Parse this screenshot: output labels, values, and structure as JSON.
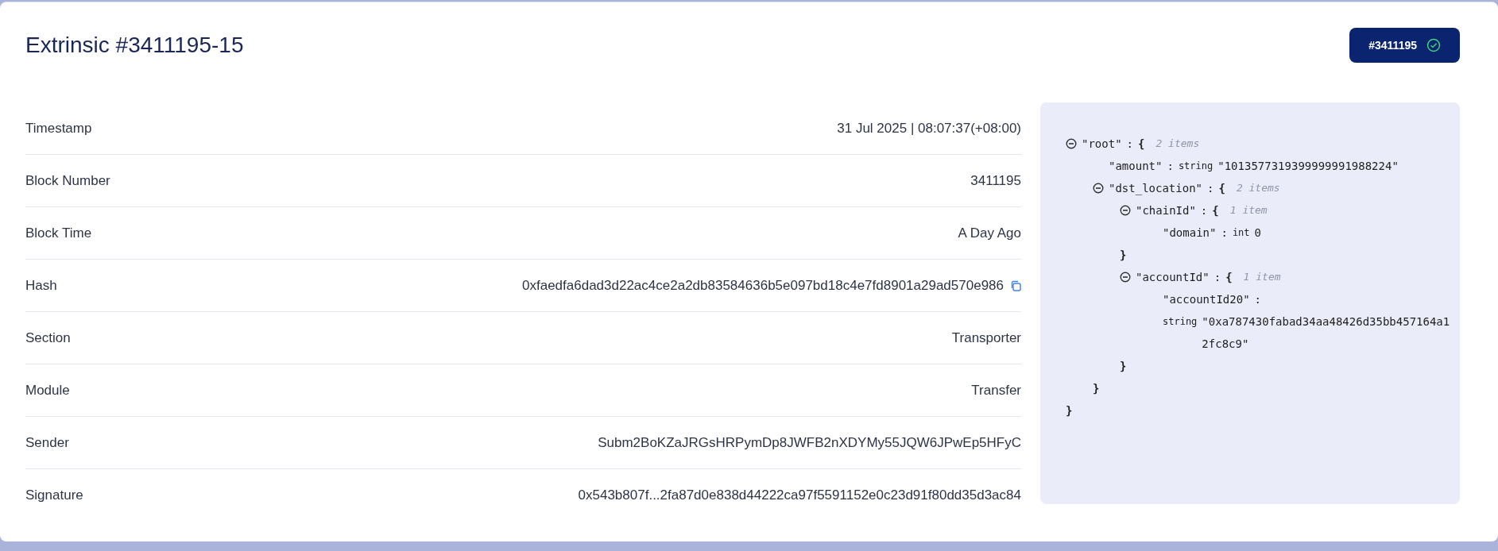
{
  "title": "Extrinsic #3411195-15",
  "block_badge": {
    "label": "#3411195",
    "success": true
  },
  "details": [
    {
      "label": "Timestamp",
      "value": "31 Jul 2025 | 08:07:37(+08:00)"
    },
    {
      "label": "Block Number",
      "value": "3411195"
    },
    {
      "label": "Block Time",
      "value": "A Day Ago"
    },
    {
      "label": "Hash",
      "value": "0xfaedfa6dad3d22ac4ce2a2db83584636b5e097bd18c4e7fd8901a29ad570e986",
      "copyable": true
    },
    {
      "label": "Section",
      "value": "Transporter"
    },
    {
      "label": "Module",
      "value": "Transfer"
    },
    {
      "label": "Sender",
      "value": "Subm2BoKZaJRGsHRPymDp8JWFB2nXDYMy55JQW6JPwEp5HFyC"
    },
    {
      "label": "Signature",
      "value": "0x543b807f...2fa87d0e838d44222ca97f5591152e0c23d91f80dd35d3ac84"
    }
  ],
  "params_tree": {
    "key": "\"root\"",
    "colon": ":",
    "open": "{",
    "count": "2 items",
    "close": "}",
    "expanded": true,
    "children": [
      {
        "key": "\"amount\"",
        "colon": ":",
        "type": "string",
        "value": "\"1013577319399999991988224\""
      },
      {
        "key": "\"dst_location\"",
        "colon": ":",
        "open": "{",
        "count": "2 items",
        "close": "}",
        "expanded": true,
        "children": [
          {
            "key": "\"chainId\"",
            "colon": ":",
            "open": "{",
            "count": "1 item",
            "close": "}",
            "expanded": true,
            "children": [
              {
                "key": "\"domain\"",
                "colon": ":",
                "type": "int",
                "value": "0"
              }
            ]
          },
          {
            "key": "\"accountId\"",
            "colon": ":",
            "open": "{",
            "count": "1 item",
            "close": "}",
            "expanded": true,
            "children": [
              {
                "key": "\"accountId20\"",
                "colon": ":",
                "type": "string",
                "value": "\"0xa787430fabad34aa48426d35bb457164a12fc8c9\""
              }
            ]
          }
        ]
      }
    ]
  }
}
